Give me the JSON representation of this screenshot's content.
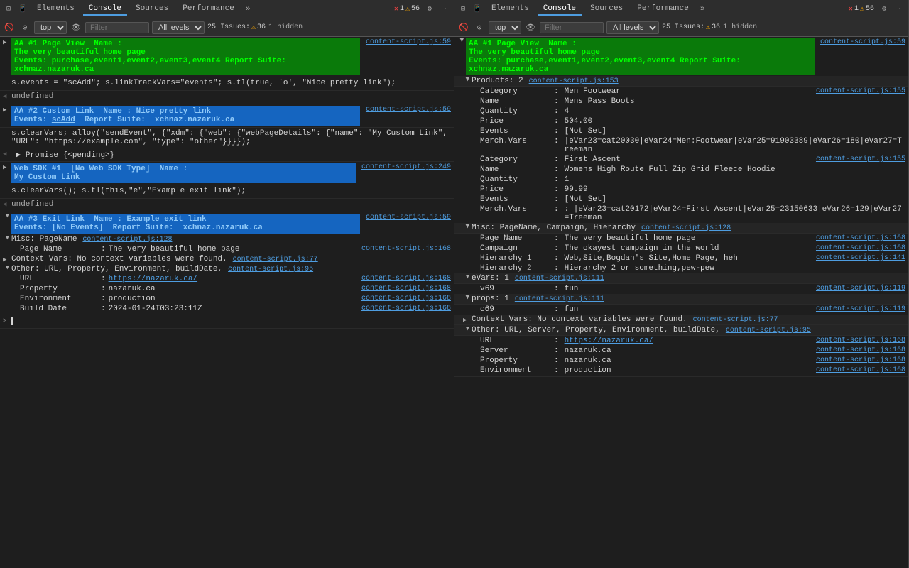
{
  "left_panel": {
    "tabs": [
      "Elements",
      "Console",
      "Sources",
      "Performance"
    ],
    "active_tab": "Console",
    "toolbar": {
      "top_label": "top",
      "filter_placeholder": "Filter",
      "levels_label": "All levels",
      "issues_label": "25 Issues:",
      "issues_count": "36",
      "hidden_label": "1 hidden",
      "error_count": "1",
      "warn_count": "56"
    },
    "entries": [
      {
        "id": "entry1",
        "type": "aa_highlight",
        "arrow": "▶",
        "line1": "AA #1 Page View  Name :",
        "line2": "The very beautiful home page",
        "line3": "Events: purchase,event1,event2,event3,event4 Report Suite:",
        "line4": "xchnaz.nazaruk.ca",
        "source": "content-script.js:59"
      },
      {
        "id": "entry2",
        "type": "code",
        "text": "s.events = \"scAdd\"; s.linkTrackVars=\"events\"; s.tl(true, 'o', \"Nice pretty link\");",
        "source": ""
      },
      {
        "id": "entry3",
        "type": "plain",
        "text": "undefined",
        "source": ""
      },
      {
        "id": "entry4",
        "type": "aa_highlight_blue",
        "arrow": "▶",
        "line1": "AA #2 Custom Link  Name : Nice pretty link",
        "line2": "Events: scAdd  Report Suite:  xchnaz.nazaruk.ca",
        "source": "content-script.js:59"
      },
      {
        "id": "entry5",
        "type": "code",
        "text": "s.clearVars; alloy(\"sendEvent\", {\"xdm\": {\"web\": {\"webPageDetails\": {\"name\": \"My Custom Link\", \"URL\": \"https://example.com\", \"type\": \"other\"}}}});",
        "source": ""
      },
      {
        "id": "entry6",
        "type": "promise",
        "text": "◀ Promise {<pending>}",
        "source": ""
      },
      {
        "id": "entry7",
        "type": "aa_highlight_blue2",
        "arrow": "▶",
        "line1": "Web SDK #1  [No Web SDK Type]  Name :",
        "line2": "My Custom Link",
        "source": "content-script.js:249"
      },
      {
        "id": "entry8",
        "type": "code",
        "text": "s.clearVars(); s.tl(this,\"e\",\"Example exit link\");",
        "source": ""
      },
      {
        "id": "entry9",
        "type": "plain",
        "text": "undefined",
        "source": ""
      },
      {
        "id": "entry10",
        "type": "aa_highlight_expanded",
        "arrow": "▼",
        "line1": "AA #3 Exit Link  Name : Example exit link",
        "line2": "Events: [No Events]  Report Suite:  xchnaz.nazaruk.ca",
        "source": "content-script.js:59",
        "sections": [
          {
            "id": "misc_pagename",
            "arrow": "▼",
            "label": "Misc: PageName",
            "source": "content-script.js:128",
            "rows": [
              {
                "key": "Page Name",
                "val": ": The very beautiful home page",
                "src": "content-script.js:168"
              }
            ]
          },
          {
            "id": "context_vars",
            "arrow": "▶",
            "label": "Context Vars: No context variables were found.",
            "source": "content-script.js:77"
          },
          {
            "id": "other_url",
            "arrow": "▼",
            "label": "Other: URL, Property, Environment, buildDate,",
            "source": "content-script.js:95",
            "rows": [
              {
                "key": "URL",
                "val": ": https://nazaruk.ca/",
                "src": "content-script.js:168",
                "link": true
              },
              {
                "key": "Property",
                "val": ": nazaruk.ca",
                "src": "content-script.js:168"
              },
              {
                "key": "Environment",
                "val": ": production",
                "src": "content-script.js:168"
              },
              {
                "key": "Build Date",
                "val": ": 2024-01-24T03:23:11Z",
                "src": "content-script.js:168"
              }
            ]
          }
        ]
      },
      {
        "id": "entry11",
        "type": "cursor",
        "text": ""
      }
    ]
  },
  "right_panel": {
    "tabs": [
      "Elements",
      "Console",
      "Sources",
      "Performance"
    ],
    "active_tab": "Console",
    "toolbar": {
      "top_label": "top",
      "filter_placeholder": "Filter",
      "levels_label": "All levels",
      "issues_label": "25 Issues:",
      "issues_count": "36",
      "hidden_label": "1 hidden",
      "error_count": "1",
      "warn_count": "56"
    },
    "aa_entry": {
      "arrow": "▼",
      "line1": "AA #1 Page View  Name :",
      "line2": "The very beautiful home page",
      "line3": "Events: purchase,event1,event2,event3,event4 Report Suite:",
      "line4": "xchnaz.nazaruk.ca",
      "source": "content-script.js:59"
    },
    "products": {
      "arrow": "▼",
      "label": "Products: 2",
      "source": "content-script.js:153",
      "items": [
        {
          "category_label": "Category",
          "category_val": ": Men Footwear",
          "category_src": "content-script.js:155",
          "name_label": "Name",
          "name_val": ": Mens Pass Boots",
          "qty_label": "Quantity",
          "qty_val": ": 4",
          "price_label": "Price",
          "price_val": ": 504.00",
          "events_label": "Events",
          "events_val": ": [Not Set]",
          "merch_label": "Merch.Vars",
          "merch_val": ": |eVar23=cat20030|eVar24=Men:Footwear|eVar25=91903389|eVar26=180|eVar27=Treeman"
        },
        {
          "category_label": "Category",
          "category_val": ": First Ascent",
          "category_src": "content-script.js:155",
          "name_label": "Name",
          "name_val": ": Womens High Route Full Zip Grid Fleece Hoodie",
          "qty_label": "Quantity",
          "qty_val": ": 1",
          "price_label": "Price",
          "price_val": ": 99.99",
          "events_label": "Events",
          "events_val": ": [Not Set]",
          "merch_label": "Merch.Vars",
          "merch_val": ": |eVar23=cat20172|eVar24=First Ascent|eVar25=23150633|eVar26=129|eVar27=Treeman"
        }
      ]
    },
    "misc_section": {
      "arrow": "▼",
      "label": "Misc: PageName, Campaign, Hierarchy",
      "source": "content-script.js:128",
      "rows": [
        {
          "key": "Page Name",
          "val": ": The very beautiful home page",
          "src": "content-script.js:168"
        },
        {
          "key": "Campaign",
          "val": ": The okayest campaign in the world",
          "src": "content-script.js:168"
        },
        {
          "key": "Hierarchy 1",
          "val": ": Web,Site,Bogdan's Site,Home Page, heh",
          "src": "content-script.js:141"
        },
        {
          "key": "Hierarchy 2",
          "val": ": Hierarchy 2 or something,pew-pew",
          "src": ""
        }
      ]
    },
    "evars_section": {
      "arrow": "▼",
      "label": "eVars: 1",
      "source": "content-script.js:111",
      "rows": [
        {
          "key": "v69",
          "val": ": fun",
          "src": "content-script.js:119"
        }
      ]
    },
    "props_section": {
      "arrow": "▼",
      "label": "props: 1",
      "source": "content-script.js:111",
      "rows": [
        {
          "key": "c69",
          "val": ": fun",
          "src": "content-script.js:119"
        }
      ]
    },
    "context_vars_section": {
      "arrow": "▶",
      "label": "Context Vars: No context variables were found.",
      "source": "content-script.js:77"
    },
    "other_section": {
      "arrow": "▼",
      "label": "Other: URL, Server, Property, Environment, buildDate,",
      "source": "content-script.js:95",
      "rows": [
        {
          "key": "URL",
          "val": ": https://nazaruk.ca/",
          "src": "content-script.js:168",
          "link": true
        },
        {
          "key": "Server",
          "val": ": nazaruk.ca",
          "src": "content-script.js:168"
        },
        {
          "key": "Property",
          "val": ": nazaruk.ca",
          "src": "content-script.js:168"
        },
        {
          "key": "Environment",
          "val": ": production",
          "src": "content-script.js:168"
        }
      ]
    }
  }
}
